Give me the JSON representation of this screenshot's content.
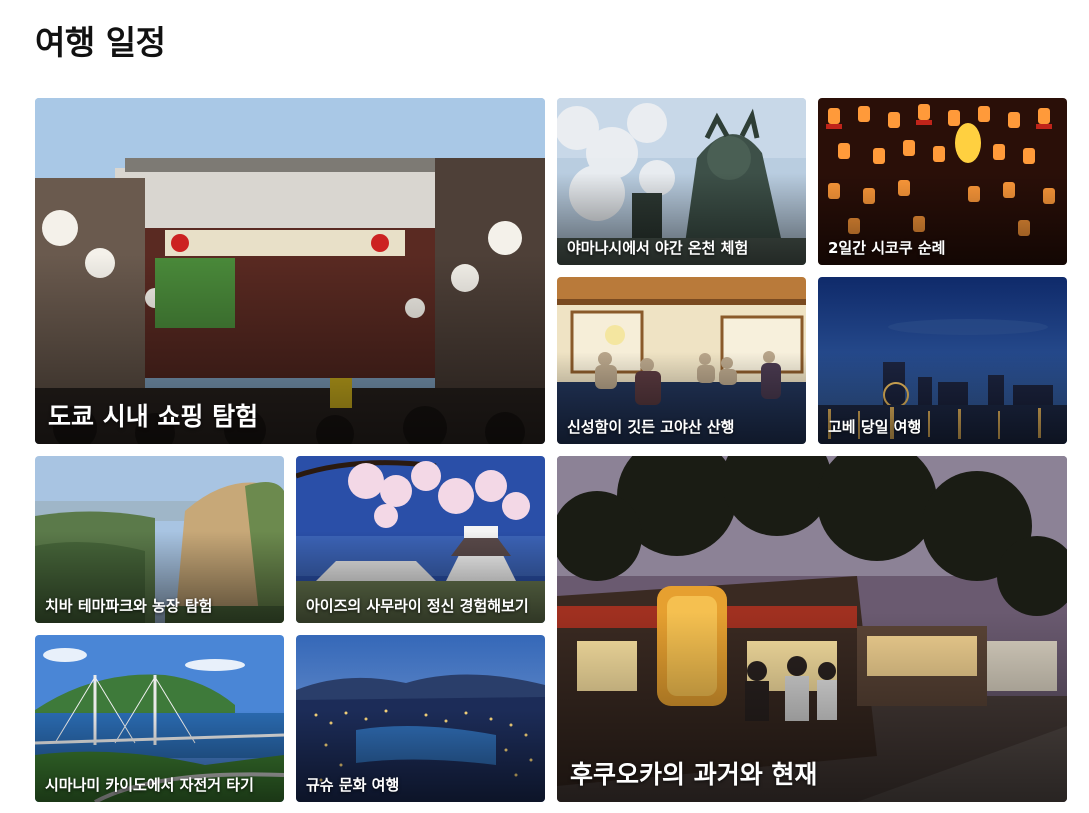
{
  "page": {
    "title": "여행 일정"
  },
  "tiles": [
    {
      "id": "tokyo",
      "label": "도쿄 시내 쇼핑 탐험",
      "icon": "temple-gate-photo"
    },
    {
      "id": "yamanashi",
      "label": "야마나시에서 야간 온천 체험",
      "icon": "samurai-statue-photo"
    },
    {
      "id": "shikoku",
      "label": "2일간 시코쿠 순례",
      "icon": "lanterns-photo"
    },
    {
      "id": "koyasan",
      "label": "신성함이 깃든 고야산 산행",
      "icon": "temple-room-photo"
    },
    {
      "id": "kobe",
      "label": "고베 당일 여행",
      "icon": "night-harbor-photo"
    },
    {
      "id": "chiba",
      "label": "치바 테마파크와 농장 탐험",
      "icon": "cliff-photo"
    },
    {
      "id": "aizu",
      "label": "아이즈의 사무라이 정신 경험해보기",
      "icon": "castle-photo"
    },
    {
      "id": "fukuoka",
      "label": "후쿠오카의 과거와 현재",
      "icon": "food-stalls-photo"
    },
    {
      "id": "shimanami",
      "label": "시마나미 카이도에서 자전거 타기",
      "icon": "bridge-photo"
    },
    {
      "id": "kyushu",
      "label": "규슈 문화 여행",
      "icon": "city-night-photo"
    }
  ]
}
